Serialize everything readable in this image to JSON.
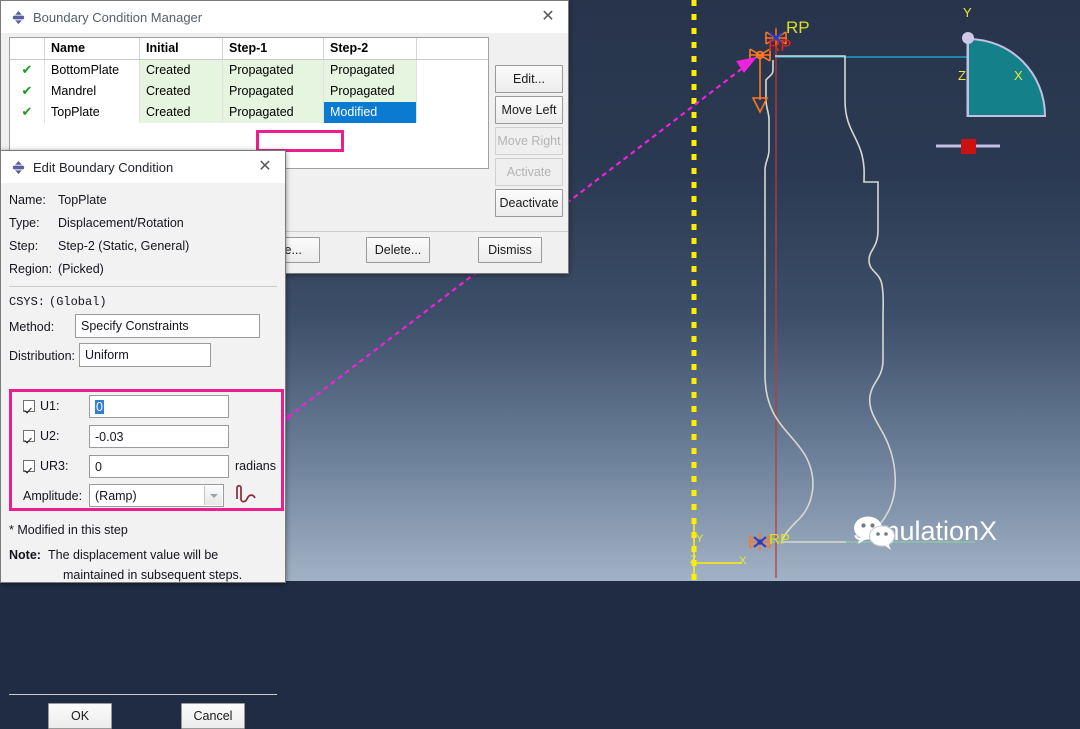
{
  "app": "Abaqus/CAE",
  "viewport": {
    "background_top": "#27344c",
    "background_bottom": "#a2b2c6",
    "labels": {
      "rp_top_yellow": "RP",
      "rp_top_red": "RP",
      "rp_bottom": "RP",
      "triad_x": "X",
      "triad_y": "Y",
      "triad_z": "Z",
      "origin_x": "X",
      "origin_y": "Y",
      "origin_z": "Z"
    },
    "colors": {
      "symmetry_axis": "#ffee00",
      "callout_arrow": "#ee22dd",
      "bc_symbol": "#ff7722",
      "rp_yellow": "#dddd22",
      "rp_red": "#ee2211",
      "part_outline": "#d8d8cf",
      "axis_line": "#b93b3b",
      "rigid_line": "#1f9ec9",
      "triad_fill": "#14808a",
      "triad_stem": "#c3c0e3",
      "triad_node": "#cc1111"
    }
  },
  "watermark": {
    "text": "SimulationX",
    "icon": "wechat-icon"
  },
  "bc_manager": {
    "title": "Boundary Condition Manager",
    "icon": "abaqus-icon",
    "close_icon": "close-icon",
    "table": {
      "headers": [
        "",
        "Name",
        "Initial",
        "Step-1",
        "Step-2"
      ],
      "rows": [
        {
          "check": "✔",
          "name": "BottomPlate",
          "initial": "Created",
          "step1": "Propagated",
          "step2": "Propagated",
          "selected": false
        },
        {
          "check": "✔",
          "name": "Mandrel",
          "initial": "Created",
          "step1": "Propagated",
          "step2": "Propagated",
          "selected": false
        },
        {
          "check": "✔",
          "name": "TopPlate",
          "initial": "Created",
          "step1": "Propagated",
          "step2": "Modified",
          "selected": true
        }
      ]
    },
    "side_buttons": [
      {
        "label": "Edit...",
        "enabled": true
      },
      {
        "label": "Move Left",
        "enabled": true
      },
      {
        "label": "Move Right",
        "enabled": false
      },
      {
        "label": "Activate",
        "enabled": false
      },
      {
        "label": "Deactivate",
        "enabled": true
      }
    ],
    "bottom_buttons": [
      {
        "label": "me...",
        "full": "Rename..."
      },
      {
        "label": "Delete..."
      },
      {
        "label": "Dismiss"
      }
    ],
    "highlight_color": "#ea1e8c"
  },
  "edit_bc": {
    "title": "Edit Boundary Condition",
    "icon": "abaqus-icon",
    "close_icon": "close-icon",
    "fields": {
      "name_label": "Name:",
      "name_value": "TopPlate",
      "type_label": "Type:",
      "type_value": "Displacement/Rotation",
      "step_label": "Step:",
      "step_value": "Step-2 (Static, General)",
      "region_label": "Region:",
      "region_value": "(Picked)",
      "csys_label": "CSYS:",
      "csys_value": "(Global)",
      "method_label": "Method:",
      "method_value": "Specify Constraints",
      "distribution_label": "Distribution:",
      "distribution_value": "Uniform"
    },
    "constraints": [
      {
        "label": "U1:",
        "checked": true,
        "value": "0",
        "unit": "",
        "selected": true
      },
      {
        "label": "U2:",
        "checked": true,
        "value": "-0.03",
        "unit": "",
        "selected": false
      },
      {
        "label": "UR3:",
        "checked": true,
        "value": "0",
        "unit": "radians",
        "selected": false
      }
    ],
    "amplitude_label": "Amplitude:",
    "amplitude_value": "(Ramp)",
    "amplitude_icon": "amplitude-curve-icon",
    "modified_note": "* Modified in this step",
    "note_label": "Note:",
    "note_line1": "The displacement value will be",
    "note_line2": "maintained in subsequent steps.",
    "ok_label": "OK",
    "cancel_label": "Cancel",
    "highlight_color": "#ea1e8c"
  }
}
